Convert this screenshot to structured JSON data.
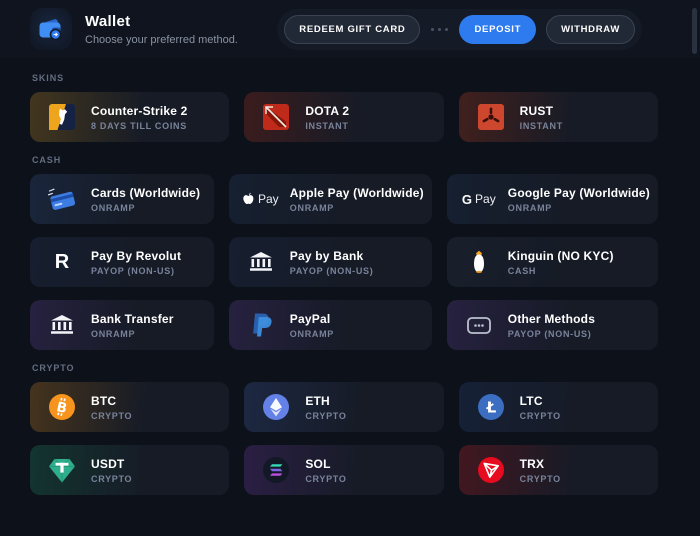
{
  "header": {
    "title": "Wallet",
    "subtitle": "Choose your preferred method.",
    "actions": {
      "redeem": "REDEEM GIFT CARD",
      "deposit": "DEPOSIT",
      "withdraw": "WITHDRAW"
    },
    "icon": "wallet-icon"
  },
  "colors": {
    "accent": "#2e7bf0",
    "page_bg": "#0d1119",
    "card_base": "#161b26"
  },
  "sections": [
    {
      "label": "SKINS",
      "cards": [
        {
          "title": "Counter-Strike 2",
          "subtitle": "8 DAYS TILL COINS",
          "icon": "cs2-icon",
          "tint": "rgba(190,140,40,0.30)"
        },
        {
          "title": "DOTA 2",
          "subtitle": "INSTANT",
          "icon": "dota2-icon",
          "tint": "rgba(190,60,40,0.26)"
        },
        {
          "title": "RUST",
          "subtitle": "INSTANT",
          "icon": "rust-icon",
          "tint": "rgba(200,70,40,0.28)"
        }
      ]
    },
    {
      "label": "CASH",
      "cards": [
        {
          "title": "Cards (Worldwide)",
          "subtitle": "ONRAMP",
          "icon": "credit-card-icon",
          "tint": "rgba(70,110,180,0.22)"
        },
        {
          "title": "Apple Pay (Worldwide)",
          "subtitle": "ONRAMP",
          "icon": "apple-pay-icon",
          "tint": "rgba(60,90,140,0.20)"
        },
        {
          "title": "Google Pay (Worldwide)",
          "subtitle": "ONRAMP",
          "icon": "google-pay-icon",
          "tint": "rgba(60,90,140,0.20)"
        },
        {
          "title": "Pay By Revolut",
          "subtitle": "PAYOP (NON-US)",
          "icon": "revolut-icon",
          "tint": "rgba(60,90,150,0.18)"
        },
        {
          "title": "Pay by Bank",
          "subtitle": "PAYOP (NON-US)",
          "icon": "bank-icon",
          "tint": "rgba(60,90,150,0.18)"
        },
        {
          "title": "Kinguin (NO KYC)",
          "subtitle": "CASH",
          "icon": "kinguin-icon",
          "tint": "rgba(90,110,150,0.14)"
        },
        {
          "title": "Bank Transfer",
          "subtitle": "ONRAMP",
          "icon": "bank-icon",
          "tint": "rgba(130,90,200,0.22)"
        },
        {
          "title": "PayPal",
          "subtitle": "ONRAMP",
          "icon": "paypal-icon",
          "tint": "rgba(130,90,200,0.22)"
        },
        {
          "title": "Other Methods",
          "subtitle": "PAYOP (NON-US)",
          "icon": "other-methods-icon",
          "tint": "rgba(130,90,200,0.22)"
        }
      ]
    },
    {
      "label": "CRYPTO",
      "cards": [
        {
          "title": "BTC",
          "subtitle": "CRYPTO",
          "icon": "btc-icon",
          "tint": "rgba(230,150,40,0.26)"
        },
        {
          "title": "ETH",
          "subtitle": "CRYPTO",
          "icon": "eth-icon",
          "tint": "rgba(90,130,230,0.20)"
        },
        {
          "title": "LTC",
          "subtitle": "CRYPTO",
          "icon": "ltc-icon",
          "tint": "rgba(70,120,220,0.15)"
        },
        {
          "title": "USDT",
          "subtitle": "CRYPTO",
          "icon": "usdt-icon",
          "tint": "rgba(40,180,130,0.22)"
        },
        {
          "title": "SOL",
          "subtitle": "CRYPTO",
          "icon": "sol-icon",
          "tint": "rgba(150,80,220,0.22)"
        },
        {
          "title": "TRX",
          "subtitle": "CRYPTO",
          "icon": "trx-icon",
          "tint": "rgba(220,40,50,0.26)"
        }
      ]
    }
  ]
}
